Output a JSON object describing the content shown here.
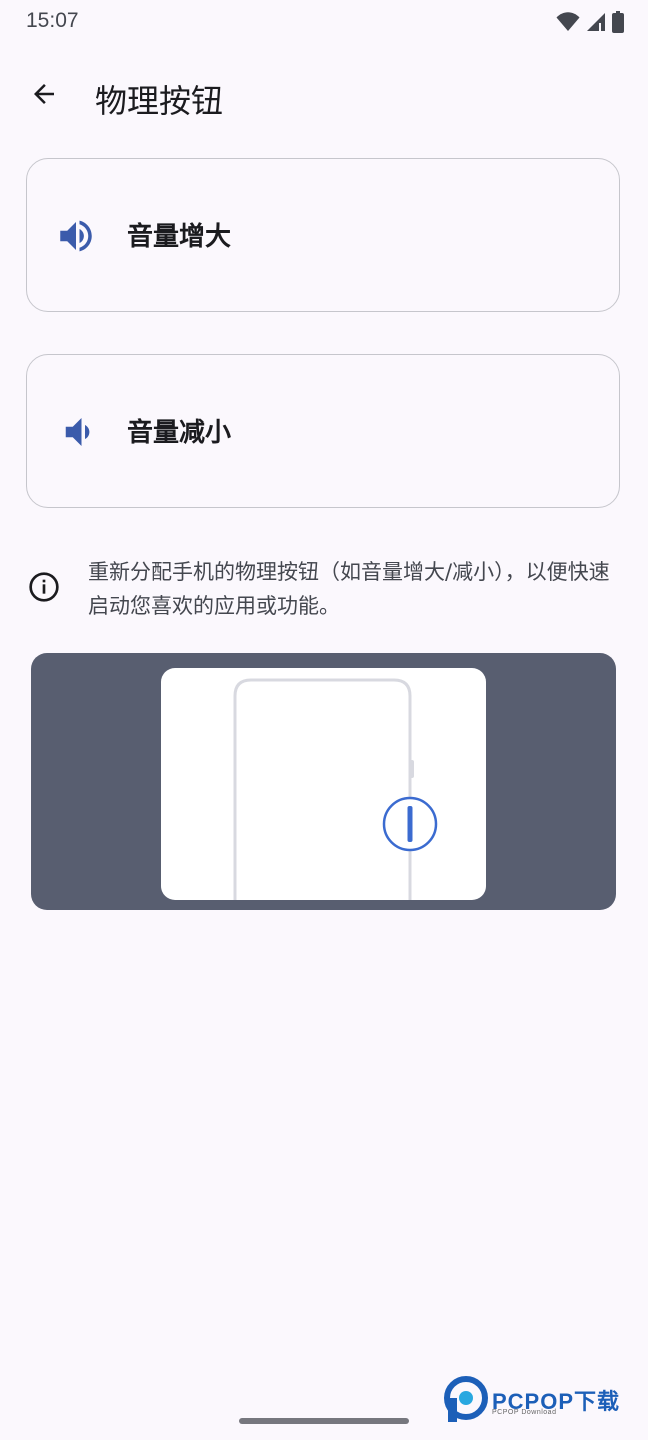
{
  "status_bar": {
    "time": "15:07",
    "icons": [
      "wifi-icon",
      "cellular-signal-icon",
      "battery-icon"
    ]
  },
  "top_bar": {
    "back_icon": "arrow-back-icon",
    "title": "物理按钮"
  },
  "buttons": [
    {
      "label": "音量增大",
      "icon": "volume-up-icon"
    },
    {
      "label": "音量减小",
      "icon": "volume-down-icon"
    }
  ],
  "info": {
    "icon": "info-icon",
    "text": "重新分配手机的物理按钮（如音量增大/减小），以便快速启动您喜欢的应用或功能。"
  },
  "illustration": {
    "description_icon": "phone-side-button-illustration"
  },
  "watermark": {
    "text": "PCPOP下载",
    "subtext": "PCPOP Download"
  },
  "colors": {
    "background": "#fbf8fd",
    "accent": "#3b5bab",
    "illustration_bg": "#585e70",
    "card_border": "#c6c6cc"
  }
}
